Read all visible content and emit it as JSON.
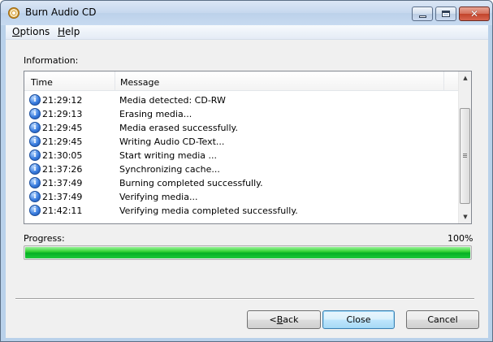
{
  "window": {
    "title": "Burn Audio CD",
    "icon": "cd-icon"
  },
  "menu": {
    "items": [
      {
        "label": "Options",
        "mnemonic": "O"
      },
      {
        "label": "Help",
        "mnemonic": "H"
      }
    ]
  },
  "information": {
    "label": "Information:",
    "columns": {
      "time": "Time",
      "message": "Message"
    },
    "rows": [
      {
        "time": "21:29:12",
        "message": "Media detected: CD-RW"
      },
      {
        "time": "21:29:13",
        "message": "Erasing media..."
      },
      {
        "time": "21:29:45",
        "message": "Media erased successfully."
      },
      {
        "time": "21:29:45",
        "message": "Writing Audio CD-Text..."
      },
      {
        "time": "21:30:05",
        "message": "Start writing media ..."
      },
      {
        "time": "21:37:26",
        "message": "Synchronizing cache..."
      },
      {
        "time": "21:37:49",
        "message": "Burning completed successfully."
      },
      {
        "time": "21:37:49",
        "message": "Verifying media..."
      },
      {
        "time": "21:42:11",
        "message": "Verifying media completed successfully."
      }
    ]
  },
  "progress": {
    "label": "Progress:",
    "percent_text": "100%",
    "value": 1.0,
    "color": "#06b025"
  },
  "buttons": {
    "back": "< Back",
    "close": "Close",
    "cancel": "Cancel"
  }
}
